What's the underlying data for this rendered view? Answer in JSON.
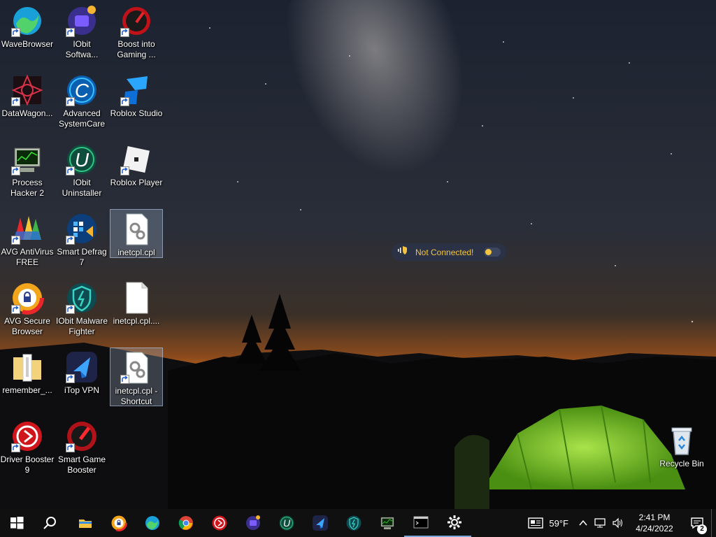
{
  "desktop": {
    "icons": [
      {
        "label": "WaveBrowser",
        "icon": "wave-browser-icon"
      },
      {
        "label": "IObit\nSoftwa...",
        "icon": "iobit-software-updater-icon"
      },
      {
        "label": "Boost into\nGaming ...",
        "icon": "boost-gaming-icon"
      },
      {
        "label": "DataWagon...",
        "icon": "datawagon-icon"
      },
      {
        "label": "Advanced\nSystemCare",
        "icon": "advanced-systemcare-icon"
      },
      {
        "label": "Roblox Studio",
        "icon": "roblox-studio-icon"
      },
      {
        "label": "Process\nHacker 2",
        "icon": "process-hacker-icon"
      },
      {
        "label": "IObit\nUninstaller",
        "icon": "iobit-uninstaller-icon"
      },
      {
        "label": "Roblox Player",
        "icon": "roblox-player-icon"
      },
      {
        "label": "AVG AntiVirus\nFREE",
        "icon": "avg-antivirus-icon"
      },
      {
        "label": "Smart Defrag\n7",
        "icon": "smart-defrag-icon"
      },
      {
        "label": "inetcpl.cpl",
        "icon": "cpl-file-icon"
      },
      {
        "label": "AVG Secure\nBrowser",
        "icon": "avg-secure-browser-icon"
      },
      {
        "label": "IObit Malware\nFighter",
        "icon": "iobit-malware-fighter-icon"
      },
      {
        "label": "inetcpl.cpl....",
        "icon": "blank-file-icon"
      },
      {
        "label": "remember_...",
        "icon": "zip-folder-icon"
      },
      {
        "label": "iTop VPN",
        "icon": "itop-vpn-icon"
      },
      {
        "label": "inetcpl.cpl -\nShortcut",
        "icon": "cpl-shortcut-icon"
      },
      {
        "label": "Driver Booster\n9",
        "icon": "driver-booster-icon"
      },
      {
        "label": "Smart Game\nBooster",
        "icon": "smart-game-booster-icon"
      }
    ],
    "recycle_bin": {
      "label": "Recycle Bin",
      "icon": "recycle-bin-icon"
    }
  },
  "vpn_widget": {
    "status": "Not Connected!",
    "accent": "#f3c441"
  },
  "taskbar": {
    "start": "windows-start-icon",
    "search": "search-icon",
    "apps": [
      "file-explorer-icon",
      "avg-secure-browser-icon",
      "wave-browser-icon",
      "chrome-icon",
      "driver-booster-icon",
      "iobit-software-updater-icon",
      "iobit-uninstaller-icon",
      "itop-vpn-icon",
      "iobit-malware-fighter-icon",
      "process-hacker-icon",
      "command-prompt-icon",
      "settings-icon"
    ],
    "weather": {
      "temp": "59°F",
      "icon": "news-weather-icon"
    },
    "clock": {
      "time": "2:41 PM",
      "date": "4/24/2022"
    },
    "notifications_count": "2"
  }
}
